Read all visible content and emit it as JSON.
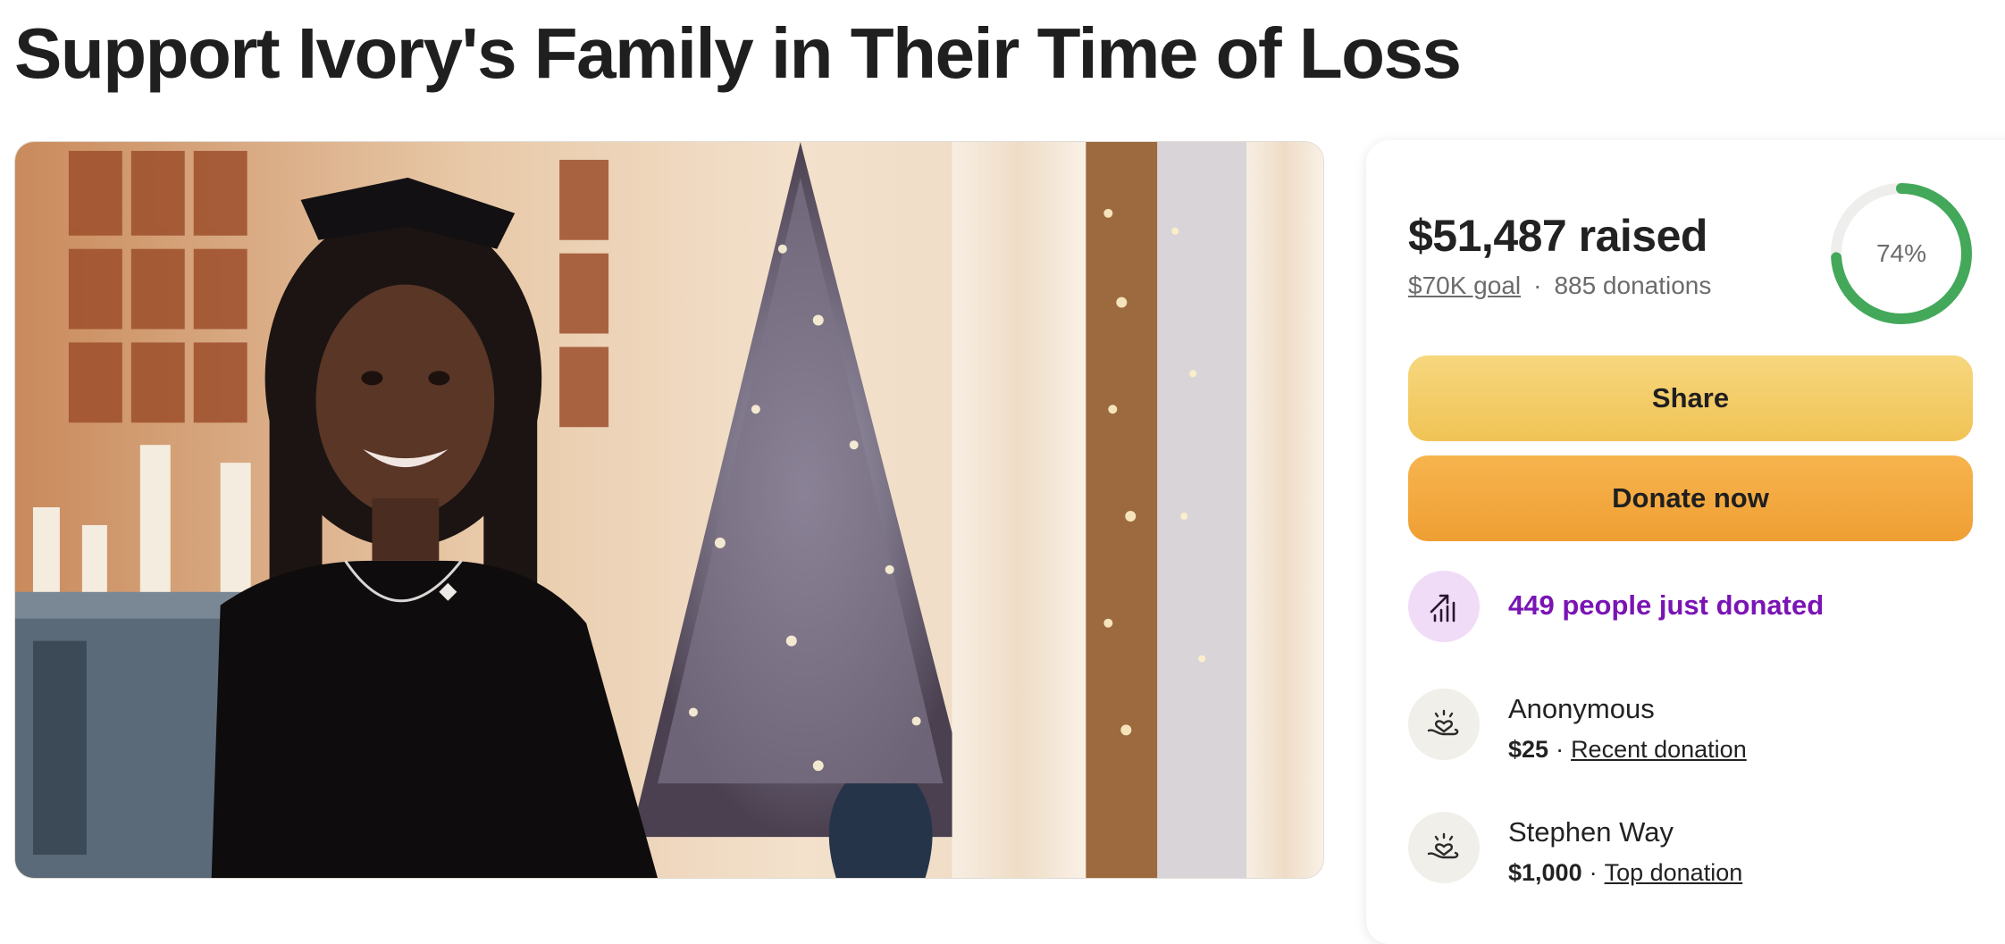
{
  "page": {
    "title": "Support Ivory's Family in Their Time of Loss"
  },
  "hero": {
    "description_icon": "fundraiser-photo"
  },
  "panel": {
    "raised": "$51,487 raised",
    "goal": "$70K goal",
    "separator": "·",
    "donations": "885 donations",
    "progress": {
      "percent": 74,
      "label": "74%"
    },
    "share_label": "Share",
    "donate_label": "Donate now",
    "trend": {
      "icon": "trending-up-icon",
      "text": "449 people just donated"
    },
    "donors": [
      {
        "name": "Anonymous",
        "amount": "$25",
        "separator": "·",
        "tag": "Recent donation",
        "icon": "heart-hand-icon"
      },
      {
        "name": "Stephen Way",
        "amount": "$1,000",
        "separator": "·",
        "tag": "Top donation",
        "icon": "heart-hand-icon"
      }
    ]
  },
  "colors": {
    "progress": "#43a85a",
    "progress_track": "#eeeeec",
    "share_button": "#f0c355",
    "donate_button": "#ef9f33",
    "trend_text": "#7a14b4",
    "trend_badge": "#f0dcf7"
  }
}
